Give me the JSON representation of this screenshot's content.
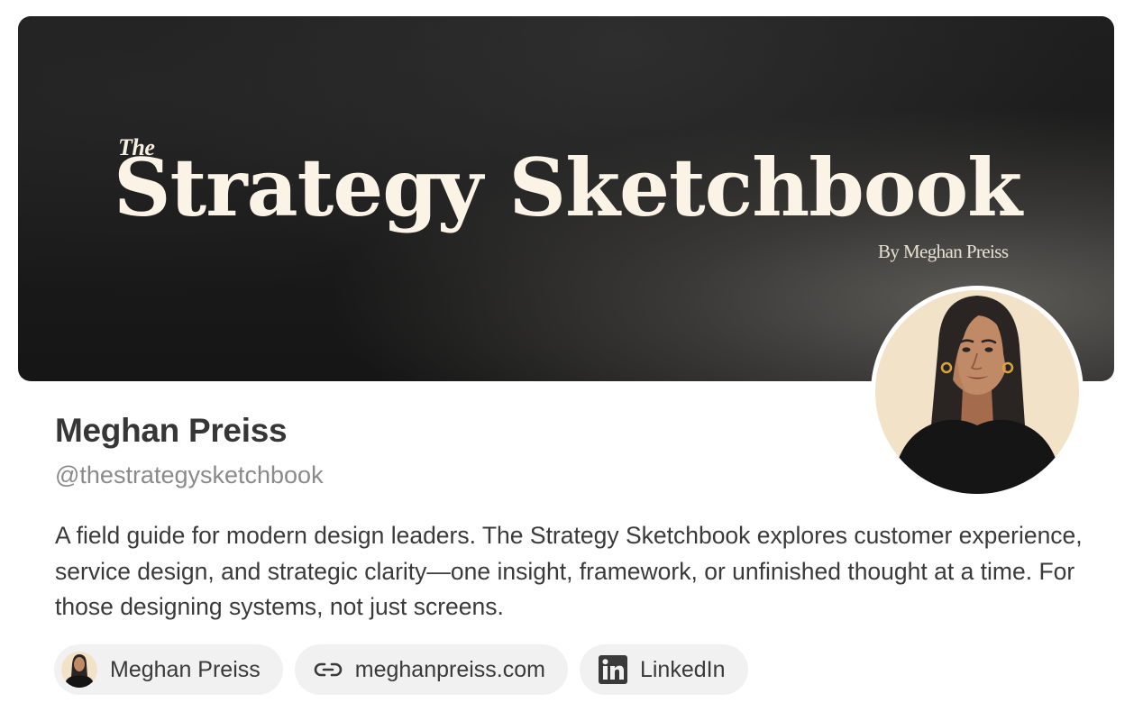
{
  "banner": {
    "the": "The",
    "title": "Strategy Sketchbook",
    "byline": "By Meghan Preiss"
  },
  "profile": {
    "name": "Meghan Preiss",
    "handle": "@thestrategysketchbook",
    "bio": "A field guide for modern design leaders. The Strategy Sketchbook explores customer experience, service design, and strategic clarity—one insight, framework, or unfinished thought at a time. For those designing systems, not just screens."
  },
  "links": [
    {
      "label": "Meghan Preiss",
      "icon": "avatar"
    },
    {
      "label": "meghanpreiss.com",
      "icon": "link-icon"
    },
    {
      "label": "LinkedIn",
      "icon": "linkedin-icon"
    }
  ],
  "colors": {
    "banner_bg": "#1a1a1a",
    "banner_text": "#fbf4e6",
    "chip_bg": "#f1f1f1",
    "avatar_bg": "#f2e2c8"
  }
}
